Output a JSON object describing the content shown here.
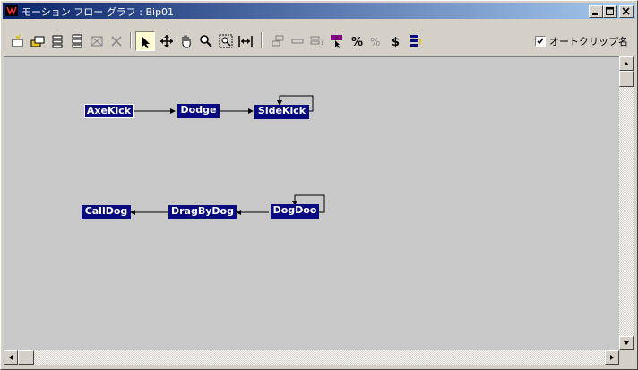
{
  "window": {
    "title": "モーション フロー グラフ : Bip01"
  },
  "toolbar": {
    "buttons": [
      {
        "name": "create-transition-icon"
      },
      {
        "name": "create-clip-icon"
      },
      {
        "name": "add-random-icon"
      },
      {
        "name": "add-script-icon"
      },
      {
        "name": "delete-icon"
      },
      {
        "name": "select-arrow-icon"
      },
      {
        "name": "move-icon"
      },
      {
        "name": "pan-hand-icon"
      },
      {
        "name": "zoom-icon"
      },
      {
        "name": "zoom-region-icon"
      },
      {
        "name": "zoom-extents-icon"
      },
      {
        "name": "show-all-icon"
      },
      {
        "name": "minus-icon"
      },
      {
        "name": "properties-icon"
      },
      {
        "name": "select-random-start-icon"
      },
      {
        "name": "percent-icon"
      },
      {
        "name": "random-transitions-icon"
      },
      {
        "name": "dollar-icon"
      },
      {
        "name": "script-icon"
      }
    ],
    "autoclip_label": "オートクリップ名",
    "autoclip_checked": true
  },
  "graph": {
    "nodes": [
      {
        "label": "AxeKick",
        "selected": true
      },
      {
        "label": "Dodge",
        "selected": false
      },
      {
        "label": "SideKick",
        "selected": false
      },
      {
        "label": "CallDog",
        "selected": false
      },
      {
        "label": "DragByDog",
        "selected": false
      },
      {
        "label": "DogDoo",
        "selected": false
      }
    ]
  },
  "colors": {
    "node_fill": "#0a0a80",
    "canvas": "#c8c8c8",
    "title_start": "#0a246a",
    "title_end": "#a6caf0"
  }
}
